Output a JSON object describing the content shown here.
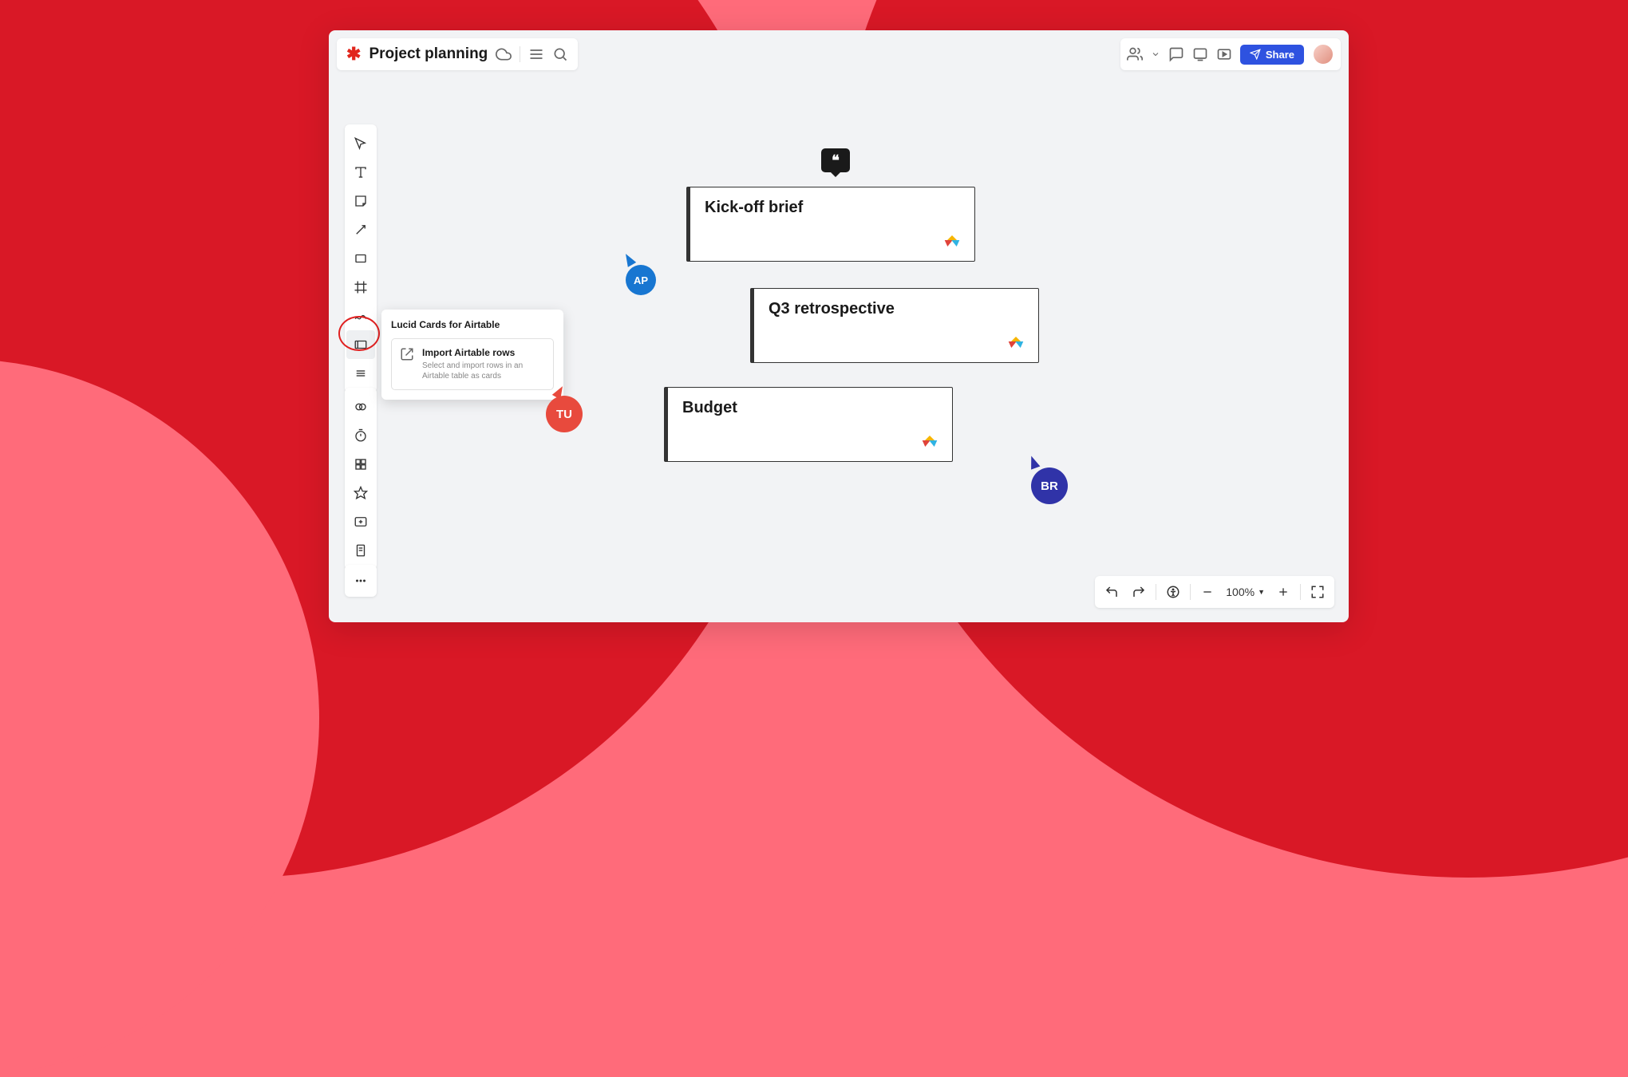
{
  "header": {
    "doc_title": "Project planning",
    "share_label": "Share"
  },
  "popover": {
    "title": "Lucid Cards for Airtable",
    "item_title": "Import Airtable rows",
    "item_desc": "Select and import rows in an Airtable table as cards"
  },
  "cards": [
    {
      "title": "Kick-off brief"
    },
    {
      "title": "Q3 retrospective"
    },
    {
      "title": "Budget"
    }
  ],
  "cursors": {
    "ap": "AP",
    "tu": "TU",
    "br": "BR"
  },
  "zoom": {
    "value": "100%"
  },
  "colors": {
    "accent_blue": "#2e52e0",
    "brand_red": "#e1261c"
  }
}
